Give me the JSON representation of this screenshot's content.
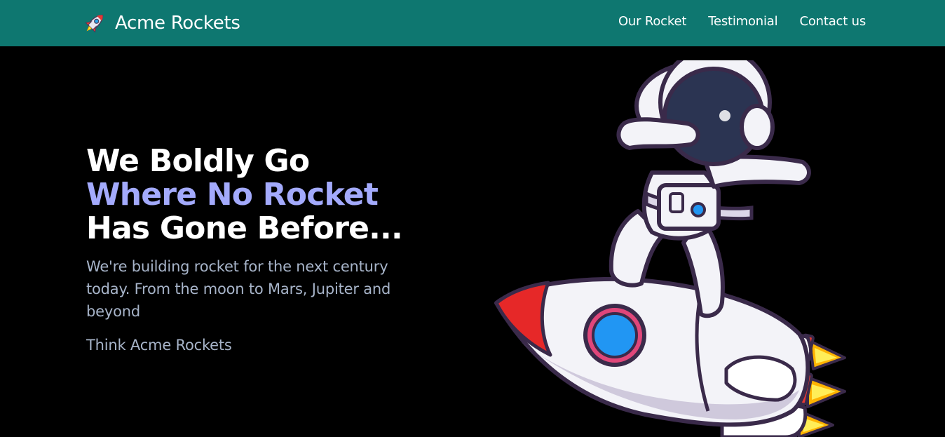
{
  "navbar": {
    "brand_name": "Acme Rockets",
    "brand_icon": "rocket-icon",
    "links": [
      {
        "label": "Our Rocket"
      },
      {
        "label": "Testimonial"
      },
      {
        "label": "Contact us"
      }
    ],
    "background": "#0e7770"
  },
  "hero": {
    "headline_line1": "We Boldly Go",
    "headline_line2": "Where No Rocket",
    "headline_line3": "Has Gone Before...",
    "tagline": "We're building rocket for the next century today. From the moon to Mars, Jupiter and beyond",
    "cta_text": "Think Acme Rockets",
    "illustration": "astronaut-on-rocket-illustration",
    "accent_color": "#a3aafc",
    "text_color": "#a7b4c9"
  }
}
